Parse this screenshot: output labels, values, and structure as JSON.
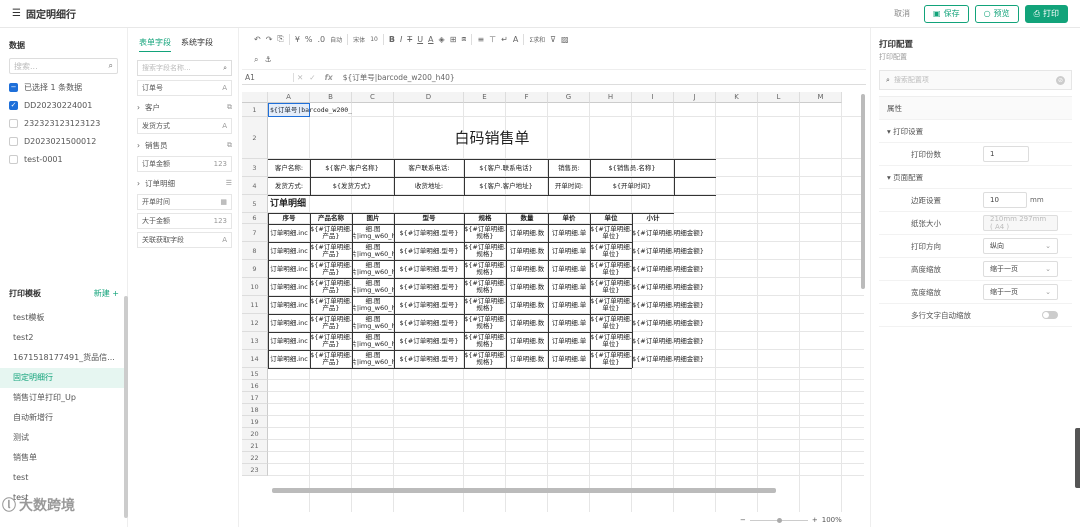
{
  "header": {
    "title": "固定明细行",
    "cancel": "取消",
    "save": "保存",
    "preview": "预览",
    "print": "打印"
  },
  "left": {
    "data_title": "数据",
    "search_placeholder": "搜索...",
    "select_summary": "已选择 1 条数据",
    "records": [
      {
        "id": "DD20230224001",
        "checked": true
      },
      {
        "id": "232323123123123",
        "checked": false
      },
      {
        "id": "D2023021500012",
        "checked": false
      },
      {
        "id": "test-0001",
        "checked": false
      }
    ],
    "templates_title": "打印模板",
    "new_label": "新建 +",
    "templates": [
      "test模板",
      "test2",
      "1671518177491_货品信...",
      "固定明细行",
      "销售订单打印_Up",
      "自动新增行",
      "测试",
      "销售单",
      "test",
      "test"
    ],
    "active_template": "固定明细行"
  },
  "fields": {
    "tab_form": "表单字段",
    "tab_system": "系统字段",
    "search_placeholder": "搜索字段名称...",
    "items": [
      {
        "label": "订单号",
        "type": "item",
        "icon": "A"
      },
      {
        "label": "客户",
        "type": "group",
        "icon": "⧉"
      },
      {
        "label": "发货方式",
        "type": "item",
        "icon": "A"
      },
      {
        "label": "销售员",
        "type": "group",
        "icon": "⧉"
      },
      {
        "label": "订单金额",
        "type": "item",
        "icon": "123"
      },
      {
        "label": "订单明细",
        "type": "group",
        "icon": "☰"
      },
      {
        "label": "开单时间",
        "type": "item",
        "icon": "▦"
      },
      {
        "label": "大于金额",
        "type": "item",
        "icon": "123"
      },
      {
        "label": "关联获取字段",
        "type": "item",
        "icon": "A"
      }
    ]
  },
  "toolbar": {
    "font": "宋体",
    "size": "10",
    "format": "自动",
    "sum": "Σ求和"
  },
  "formula": {
    "ref": "A1",
    "value": "${订单号|barcode_w200_h40}"
  },
  "sheet": {
    "columns": [
      "A",
      "B",
      "C",
      "D",
      "E",
      "F",
      "G",
      "H",
      "I",
      "J",
      "K",
      "L",
      "M"
    ],
    "a1": "${订单号|barcode_w200_h40}",
    "title": "白码销售单",
    "r3": {
      "l1": "客户名称:",
      "v1": "${客户.客户名称}",
      "l2": "客户联系电话:",
      "v2": "${客户.联系电话}",
      "l3": "销售员:",
      "v3": "${销售员.名称}"
    },
    "r4": {
      "l1": "发货方式:",
      "v1": "${发货方式}",
      "l2": "收货地址:",
      "v2": "${客户.客户地址}",
      "l3": "开单时间:",
      "v3": "${开单时间}"
    },
    "detail_title": "订单明细",
    "detail_headers": [
      "序号",
      "产品名称",
      "图片",
      "型号",
      "规格",
      "数量",
      "单价",
      "单位",
      "小计"
    ],
    "detail_cells": [
      "订单明细.inc",
      "${#订单明细.产品}",
      "细.图片|img_w60_h",
      "${#订单明细.型号}",
      "${#订单明细.规格}",
      "订单明细.数",
      "订单明细.单",
      "${#订单明细.单位}",
      "${#订单明细.明细金额}"
    ],
    "row_numbers": [
      1,
      2,
      3,
      4,
      5,
      6,
      7,
      8,
      9,
      10,
      11,
      12,
      13,
      14,
      15,
      16,
      17,
      18,
      19,
      20,
      21,
      22,
      23
    ]
  },
  "zoom": "100%",
  "props": {
    "title": "打印配置",
    "subtitle": "打印配置",
    "search_placeholder": "搜索配置项",
    "attr": "属性",
    "print_settings": "打印设置",
    "copies_label": "打印份数",
    "copies": "1",
    "page_settings": "页面配置",
    "margin_label": "边距设置",
    "margin": "10",
    "margin_unit": "mm",
    "paper_label": "纸张大小",
    "paper": "210mm 297mm ( A4 )",
    "orient_label": "打印方向",
    "orient": "纵向",
    "hscale_label": "高度缩放",
    "hscale": "缩于一页",
    "wscale_label": "宽度缩放",
    "wscale": "缩于一页",
    "multiline_label": "多行文字自动缩放"
  },
  "watermark": "大数跨境"
}
